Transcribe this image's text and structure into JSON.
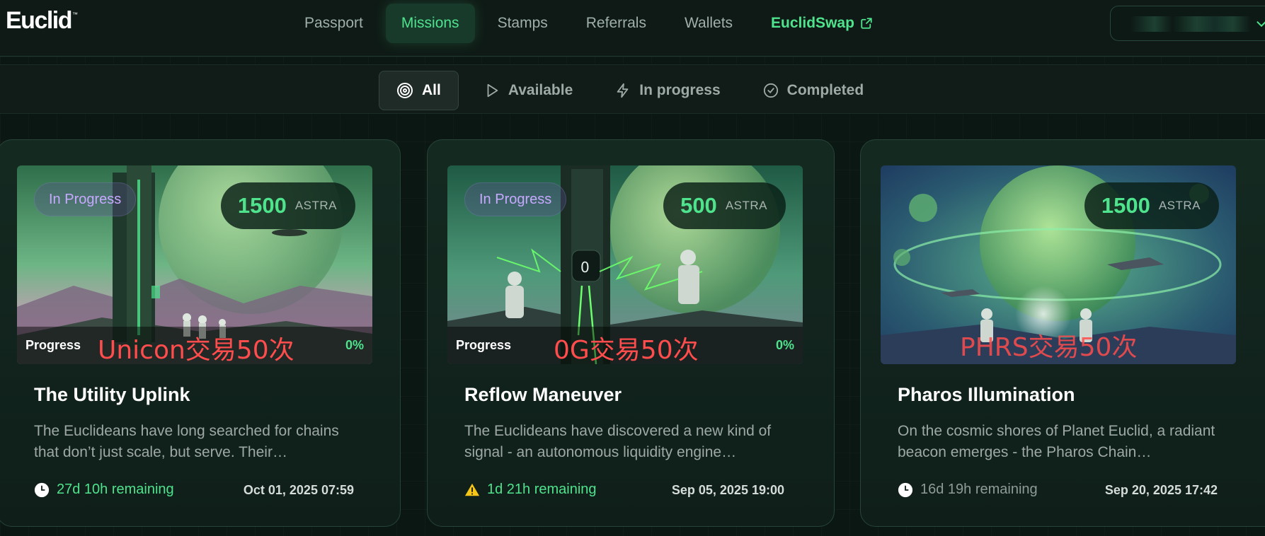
{
  "brand": {
    "name": "Euclid",
    "tm": "™"
  },
  "nav": {
    "items": [
      {
        "label": "Passport"
      },
      {
        "label": "Missions"
      },
      {
        "label": "Stamps"
      },
      {
        "label": "Referrals"
      },
      {
        "label": "Wallets"
      },
      {
        "label": "EuclidSwap",
        "icon": "external-link-icon"
      }
    ],
    "active": "Missions"
  },
  "wallet": {
    "chevron_icon": "chevron-down-icon"
  },
  "filters": {
    "items": [
      {
        "label": "All",
        "icon": "target-icon"
      },
      {
        "label": "Available",
        "icon": "play-icon"
      },
      {
        "label": "In progress",
        "icon": "lightning-icon"
      },
      {
        "label": "Completed",
        "icon": "check-circle-icon"
      }
    ],
    "active": "All"
  },
  "colors": {
    "accent": "#4ee38c",
    "status_purple": "#c7a9ff",
    "overlay_red": "#ff4d4d",
    "warning": "#f5c518"
  },
  "cards": [
    {
      "status": "In Progress",
      "reward_amount": "1500",
      "reward_currency": "ASTRA",
      "progress_label": "Progress",
      "progress_value": "0%",
      "overlay_text": "Unicon交易50次",
      "title": "The Utility Uplink",
      "description": "The Euclideans have long searched for chains that don’t just scale, but serve. Their…",
      "remaining": "27d 10h remaining",
      "remaining_icon": "clock-icon",
      "date": "Oct 01, 2025 07:59"
    },
    {
      "status": "In Progress",
      "reward_amount": "500",
      "reward_currency": "ASTRA",
      "progress_label": "Progress",
      "progress_value": "0%",
      "overlay_text": "0G交易50次",
      "title": "Reflow Maneuver",
      "description": "The Euclideans have discovered a new kind of signal - an autonomous liquidity engine…",
      "remaining": "1d 21h remaining",
      "remaining_icon": "warning-icon",
      "date": "Sep 05, 2025 19:00"
    },
    {
      "reward_amount": "1500",
      "reward_currency": "ASTRA",
      "overlay_text": "PHRS交易50次",
      "title": "Pharos Illumination",
      "description": "On the cosmic shores of Planet Euclid, a radiant beacon emerges - the Pharos Chain…",
      "remaining": "16d 19h remaining",
      "remaining_icon": "clock-icon",
      "date": "Sep 20, 2025 17:42"
    }
  ]
}
